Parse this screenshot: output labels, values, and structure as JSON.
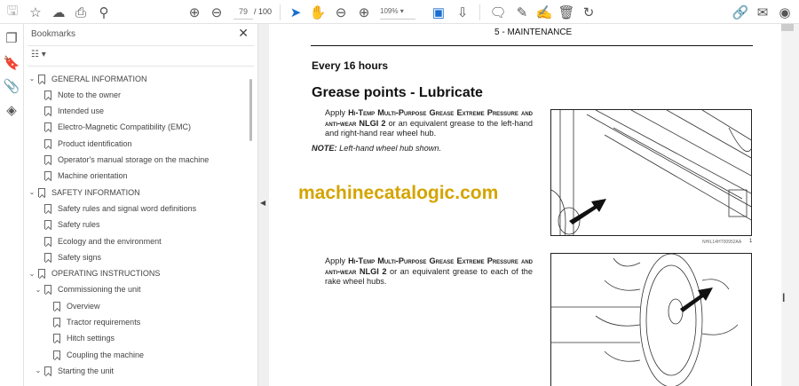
{
  "toolbar": {
    "page_current": "79",
    "page_total": "/ 100",
    "zoom": "109%"
  },
  "bookmarks_panel": {
    "title": "Bookmarks",
    "items": [
      {
        "label": "GENERAL INFORMATION",
        "level": 0,
        "expanded": true
      },
      {
        "label": "Note to the owner",
        "level": 1
      },
      {
        "label": "Intended use",
        "level": 1
      },
      {
        "label": "Electro-Magnetic Compatibility (EMC)",
        "level": 1
      },
      {
        "label": "Product identification",
        "level": 1
      },
      {
        "label": "Operator's manual storage on the machine",
        "level": 1
      },
      {
        "label": "Machine orientation",
        "level": 1
      },
      {
        "label": "SAFETY INFORMATION",
        "level": 0,
        "expanded": true
      },
      {
        "label": "Safety rules and signal word definitions",
        "level": 1
      },
      {
        "label": "Safety rules",
        "level": 1
      },
      {
        "label": "Ecology and the environment",
        "level": 1
      },
      {
        "label": "Safety signs",
        "level": 1
      },
      {
        "label": "OPERATING INSTRUCTIONS",
        "level": 0,
        "expanded": true
      },
      {
        "label": "Commissioning the unit",
        "level": 1,
        "expanded": true
      },
      {
        "label": "Overview",
        "level": 2
      },
      {
        "label": "Tractor requirements",
        "level": 2
      },
      {
        "label": "Hitch settings",
        "level": 2
      },
      {
        "label": "Coupling the machine",
        "level": 2
      },
      {
        "label": "Starting the unit",
        "level": 1,
        "expanded": true
      }
    ]
  },
  "document": {
    "header": "5 - MAINTENANCE",
    "subtitle": "Every 16 hours",
    "title": "Grease points - Lubricate",
    "para1_a": "Apply ",
    "para1_sc": "Hi-Temp Multi-Purpose Grease Extreme Pressure and anti-wear NLGI 2",
    "para1_b": " or an equivalent grease to the left-hand and right-hand rear wheel hub.",
    "note_label": "NOTE:",
    "note_text": " Left-hand wheel hub shown.",
    "para2_a": "Apply ",
    "para2_sc": "Hi-Temp Multi-Purpose Grease Extreme Pressure and anti-wear NLGI 2",
    "para2_b": " or an equivalent grease to each of the rake wheel hubs.",
    "figure1_caption": "NHIL14HT00952AA",
    "figure1_number": "1",
    "watermark": "machinecatalogic.com"
  }
}
